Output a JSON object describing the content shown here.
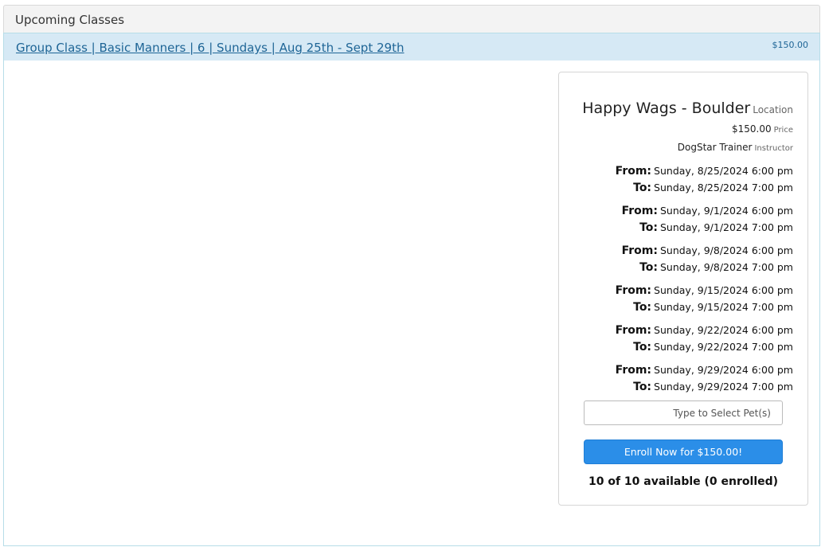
{
  "panel": {
    "title": "Upcoming Classes"
  },
  "class_row": {
    "link_text": "Group Class | Basic Manners | 6 | Sundays | Aug 25th - Sept 29th",
    "price": "$150.00"
  },
  "details": {
    "location_name": "Happy Wags - Boulder",
    "location_label": "Location",
    "price_value": "$150.00",
    "price_label": "Price",
    "instructor_name": "DogStar Trainer",
    "instructor_label": "Instructor",
    "from_label": "From:",
    "to_label": "To:",
    "sessions": [
      {
        "from": "Sunday, 8/25/2024 6:00 pm",
        "to": "Sunday, 8/25/2024 7:00 pm"
      },
      {
        "from": "Sunday, 9/1/2024 6:00 pm",
        "to": "Sunday, 9/1/2024 7:00 pm"
      },
      {
        "from": "Sunday, 9/8/2024 6:00 pm",
        "to": "Sunday, 9/8/2024 7:00 pm"
      },
      {
        "from": "Sunday, 9/15/2024 6:00 pm",
        "to": "Sunday, 9/15/2024 7:00 pm"
      },
      {
        "from": "Sunday, 9/22/2024 6:00 pm",
        "to": "Sunday, 9/22/2024 7:00 pm"
      },
      {
        "from": "Sunday, 9/29/2024 6:00 pm",
        "to": "Sunday, 9/29/2024 7:00 pm"
      }
    ],
    "pet_input": {
      "value": "",
      "placeholder": "Type to Select Pet(s)"
    },
    "enroll_button": "Enroll Now for $150.00!",
    "availability": "10 of 10 available (0 enrolled)"
  },
  "colors": {
    "accent_blue": "#2b8ee8",
    "link_blue": "#1e6596",
    "row_bg": "#d6e9f5"
  }
}
